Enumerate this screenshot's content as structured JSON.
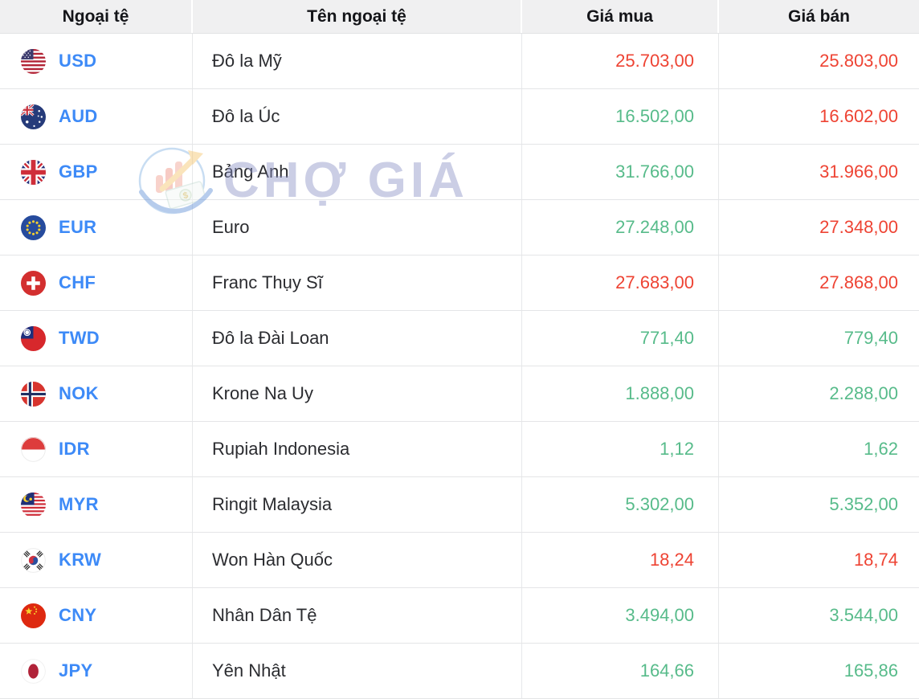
{
  "header": {
    "columns": [
      "Ngoại tệ",
      "Tên ngoại tệ",
      "Giá mua",
      "Giá bán"
    ]
  },
  "watermark": {
    "text": "CHỢ GIÁ"
  },
  "colors": {
    "code_blue": "#3d8af7",
    "negative_red": "#ee4333",
    "positive_green": "#57bb8a",
    "header_bg": "#f0f0f1"
  },
  "rows": [
    {
      "flag": "us",
      "code": "USD",
      "name": "Đô la Mỹ",
      "buy": "25.703,00",
      "buy_color": "red",
      "sell": "25.803,00",
      "sell_color": "red"
    },
    {
      "flag": "au",
      "code": "AUD",
      "name": "Đô la Úc",
      "buy": "16.502,00",
      "buy_color": "green",
      "sell": "16.602,00",
      "sell_color": "red"
    },
    {
      "flag": "gb",
      "code": "GBP",
      "name": "Bảng Anh",
      "buy": "31.766,00",
      "buy_color": "green",
      "sell": "31.966,00",
      "sell_color": "red"
    },
    {
      "flag": "eu",
      "code": "EUR",
      "name": "Euro",
      "buy": "27.248,00",
      "buy_color": "green",
      "sell": "27.348,00",
      "sell_color": "red"
    },
    {
      "flag": "ch",
      "code": "CHF",
      "name": "Franc Thụy Sĩ",
      "buy": "27.683,00",
      "buy_color": "red",
      "sell": "27.868,00",
      "sell_color": "red"
    },
    {
      "flag": "tw",
      "code": "TWD",
      "name": "Đô la Đài Loan",
      "buy": "771,40",
      "buy_color": "green",
      "sell": "779,40",
      "sell_color": "green"
    },
    {
      "flag": "no",
      "code": "NOK",
      "name": "Krone Na Uy",
      "buy": "1.888,00",
      "buy_color": "green",
      "sell": "2.288,00",
      "sell_color": "green"
    },
    {
      "flag": "id",
      "code": "IDR",
      "name": "Rupiah Indonesia",
      "buy": "1,12",
      "buy_color": "green",
      "sell": "1,62",
      "sell_color": "green"
    },
    {
      "flag": "my",
      "code": "MYR",
      "name": "Ringit Malaysia",
      "buy": "5.302,00",
      "buy_color": "green",
      "sell": "5.352,00",
      "sell_color": "green"
    },
    {
      "flag": "kr",
      "code": "KRW",
      "name": "Won Hàn Quốc",
      "buy": "18,24",
      "buy_color": "red",
      "sell": "18,74",
      "sell_color": "red"
    },
    {
      "flag": "cn",
      "code": "CNY",
      "name": "Nhân Dân Tệ",
      "buy": "3.494,00",
      "buy_color": "green",
      "sell": "3.544,00",
      "sell_color": "green"
    },
    {
      "flag": "jp",
      "code": "JPY",
      "name": "Yên Nhật",
      "buy": "164,66",
      "buy_color": "green",
      "sell": "165,86",
      "sell_color": "green"
    }
  ]
}
